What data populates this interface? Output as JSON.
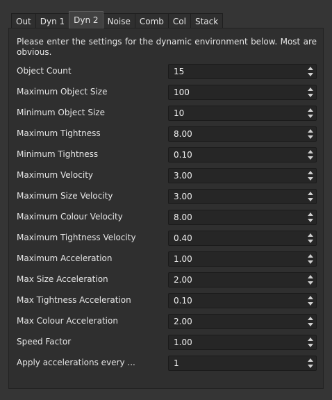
{
  "tabs": [
    {
      "label": "Out"
    },
    {
      "label": "Dyn 1"
    },
    {
      "label": "Dyn 2",
      "active": true
    },
    {
      "label": "Noise"
    },
    {
      "label": "Comb"
    },
    {
      "label": "Col"
    },
    {
      "label": "Stack"
    }
  ],
  "intro": "Please enter the settings for the dynamic environment below. Most are obvious.",
  "fields": [
    {
      "label": "Object Count",
      "value": "15"
    },
    {
      "label": "Maximum Object Size",
      "value": "100"
    },
    {
      "label": "Minimum Object Size",
      "value": "10"
    },
    {
      "label": "Maximum Tightness",
      "value": "8.00"
    },
    {
      "label": "Minimum Tightness",
      "value": "0.10"
    },
    {
      "label": "Maximum Velocity",
      "value": "3.00"
    },
    {
      "label": "Maximum Size Velocity",
      "value": "3.00"
    },
    {
      "label": "Maximum Colour Velocity",
      "value": "8.00"
    },
    {
      "label": "Maximum Tightness Velocity",
      "value": "0.40"
    },
    {
      "label": "Maximum Acceleration",
      "value": "1.00"
    },
    {
      "label": "Max Size Acceleration",
      "value": "2.00"
    },
    {
      "label": "Max Tightness Acceleration",
      "value": "0.10"
    },
    {
      "label": "Max Colour Acceleration",
      "value": "2.00"
    },
    {
      "label": "Speed Factor",
      "value": "1.00"
    },
    {
      "label": "Apply accelerations every ...",
      "value": "1"
    }
  ],
  "colors": {
    "background": "#353535",
    "panel": "#2f2f2f",
    "field": "#262626",
    "text": "#e6e6e6"
  }
}
